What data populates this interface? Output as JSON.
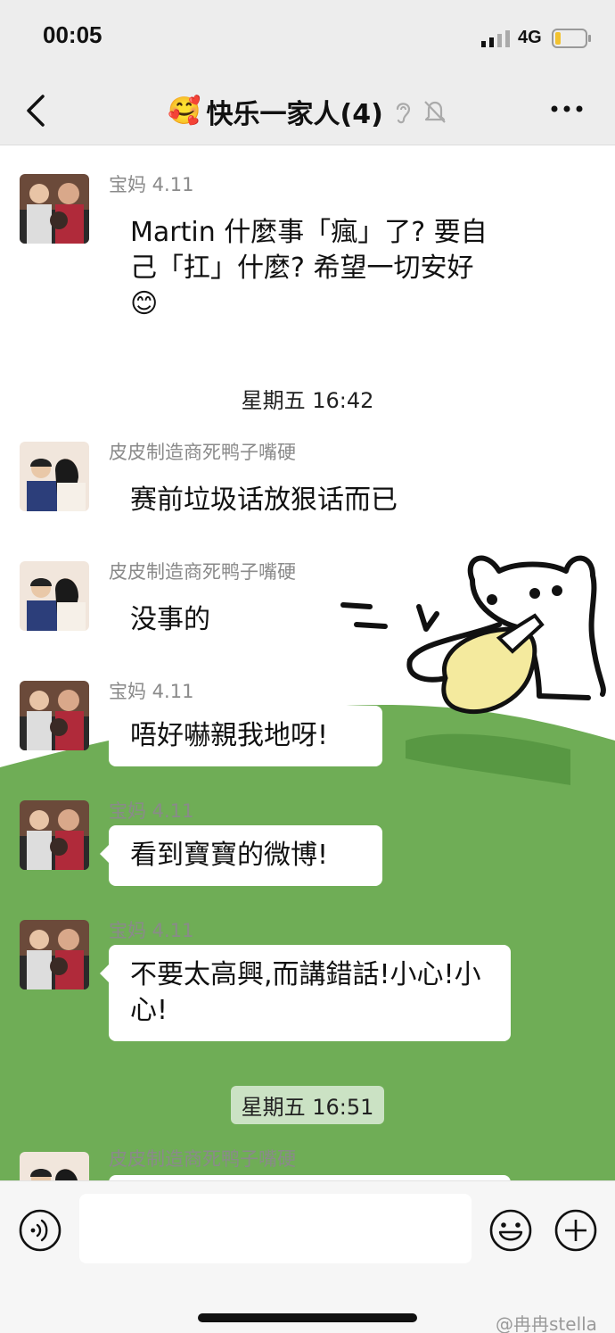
{
  "status_bar": {
    "time": "00:05",
    "network": "4G",
    "signal_icon": "signal-bars-icon",
    "battery_icon": "battery-low-icon"
  },
  "nav": {
    "title": "快乐一家人(4)",
    "emoji": "🥰",
    "back_icon": "chevron-left-icon",
    "ear_icon": "ear-icon",
    "mute_icon": "bell-muted-icon",
    "more_icon": "more-dots-icon"
  },
  "messages": [
    {
      "sender": "宝妈 4.11",
      "text": "Martin 什麼事「瘋」了? 要自己「扛」什麼? 希望一切安好 😊"
    },
    {
      "timestamp": "星期五 16:42"
    },
    {
      "sender": "皮皮制造商死鸭子嘴硬",
      "text": "赛前垃圾话放狠话而已"
    },
    {
      "sender": "皮皮制造商死鸭子嘴硬",
      "text": "没事的"
    },
    {
      "sender": "宝妈 4.11",
      "text": "唔好嚇親我地呀!"
    },
    {
      "sender": "宝妈 4.11",
      "text": "看到寶寶的微博!"
    },
    {
      "sender": "宝妈 4.11",
      "text": "不要太高興,而講錯話!小心!小心!"
    },
    {
      "timestamp": "星期五 16:51"
    },
    {
      "sender": "皮皮制造商死鸭子嘴硬",
      "text": ""
    }
  ],
  "input_bar": {
    "placeholder": "",
    "voice_icon": "voice-icon",
    "emoji_icon": "emoji-smile-icon",
    "plus_icon": "plus-circle-icon"
  },
  "watermark": "@冉冉stella",
  "colors": {
    "wallpaper_green": "#6fad56",
    "chrome_gray": "#ededed"
  }
}
